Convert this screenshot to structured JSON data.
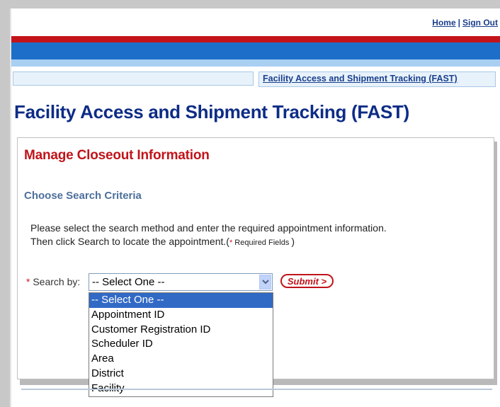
{
  "header": {
    "links": [
      {
        "label": "Home"
      },
      {
        "label": "Sign Out"
      }
    ],
    "link_separator": "|",
    "breadcrumb": "Facility Access and Shipment Tracking (FAST)"
  },
  "page": {
    "title": "Facility Access and Shipment Tracking (FAST)"
  },
  "panel": {
    "section_title": "Manage Closeout Information",
    "criteria_title": "Choose Search Criteria",
    "instruction_line1": "Please select the search method and enter the required appointment information.",
    "instruction_line2": "Then click Search to locate the appointment.",
    "required_open": "(",
    "required_star": "*",
    "required_text": " Required Fields ",
    "required_close": ")"
  },
  "search": {
    "required_star": "*",
    "label": " Search by:",
    "selected": "-- Select One --",
    "options": [
      "-- Select One --",
      "Appointment ID",
      "Customer Registration ID",
      "Scheduler ID",
      "Area",
      "District",
      "Facility"
    ],
    "submit_label": "Submit >"
  },
  "colors": {
    "brand_blue": "#0d2c86",
    "accent_red": "#c0141a",
    "bar_blue": "#1d6ec8"
  }
}
